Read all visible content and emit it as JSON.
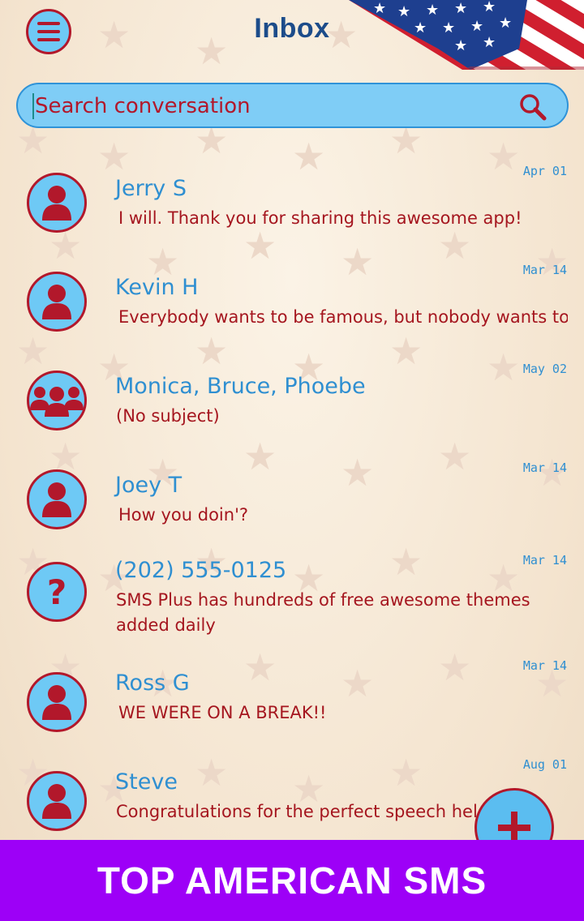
{
  "header": {
    "title": "Inbox",
    "menu_icon": "hamburger-menu-icon",
    "decoration": "us-flag"
  },
  "search": {
    "placeholder": "Search conversation",
    "icon": "search-icon"
  },
  "conversations": [
    {
      "name": "Jerry S",
      "message": "I will. Thank you for sharing this awesome app!",
      "date": "Apr 01",
      "avatar": "person-icon"
    },
    {
      "name": "Kevin H",
      "message": "Everybody wants to be famous, but nobody wants to work",
      "date": "Mar 14",
      "avatar": "person-icon"
    },
    {
      "name": "Monica, Bruce, Phoebe",
      "message": "(No subject)",
      "date": "May 02",
      "avatar": "group-icon"
    },
    {
      "name": "Joey T",
      "message": "How you doin'?",
      "date": "Mar 14",
      "avatar": "person-icon"
    },
    {
      "name": "(202) 555-0125",
      "message": "SMS Plus has hundreds of free awesome themes added daily",
      "date": "Mar 14",
      "avatar": "unknown-contact-icon"
    },
    {
      "name": "Ross G",
      "message": "WE WERE ON A BREAK!!",
      "date": "Mar 14",
      "avatar": "person-icon"
    },
    {
      "name": "Steve",
      "message": "Congratulations for the perfect speech held today",
      "date": "Aug 01",
      "avatar": "person-icon"
    }
  ],
  "fab": {
    "icon": "plus-icon"
  },
  "banner": {
    "text": "TOP AMERICAN SMS"
  },
  "colors": {
    "accent_red": "#b2182b",
    "accent_blue": "#6ec9f5",
    "name_blue": "#2f8fd1",
    "banner_purple": "#9d00f7"
  }
}
